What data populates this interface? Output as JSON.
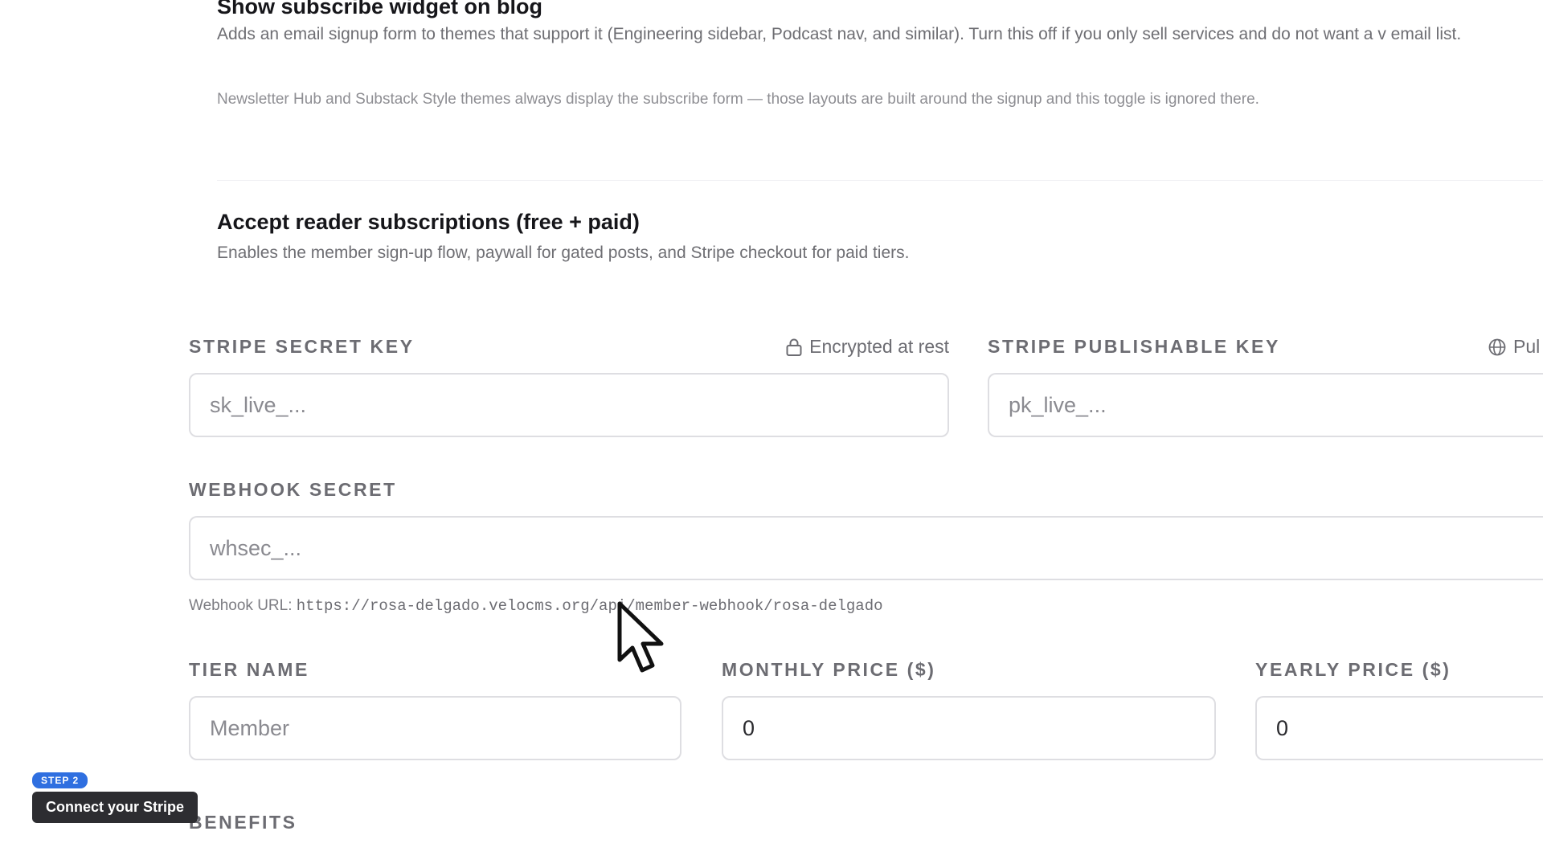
{
  "subscribe_widget": {
    "title": "Show subscribe widget on blog",
    "description": "Adds an email signup form to themes that support it (Engineering sidebar, Podcast nav, and similar). Turn this off if you only sell services and do not want a v email list.",
    "note": "Newsletter Hub and Substack Style themes always display the subscribe form — those layouts are built around the signup and this toggle is ignored there."
  },
  "reader_subscriptions": {
    "title": "Accept reader subscriptions (free + paid)",
    "description": "Enables the member sign-up flow, paywall for gated posts, and Stripe checkout for paid tiers."
  },
  "stripe": {
    "secret_key": {
      "label": "STRIPE SECRET KEY",
      "meta": "Encrypted at rest",
      "placeholder": "sk_live_..."
    },
    "publishable_key": {
      "label": "STRIPE PUBLISHABLE KEY",
      "meta": "Pul",
      "placeholder": "pk_live_..."
    },
    "webhook_secret": {
      "label": "WEBHOOK SECRET",
      "placeholder": "whsec_..."
    },
    "webhook_url": {
      "label": "Webhook URL:",
      "value": "https://rosa-delgado.velocms.org/api/member-webhook/rosa-delgado"
    }
  },
  "tier": {
    "name": {
      "label": "TIER NAME",
      "placeholder": "Member"
    },
    "monthly_price": {
      "label": "MONTHLY PRICE ($)",
      "value": "0"
    },
    "yearly_price": {
      "label": "YEARLY PRICE ($)",
      "value": "0"
    }
  },
  "benefits": {
    "label": "BENEFITS"
  },
  "tour": {
    "step_badge": "STEP 2",
    "callout": "Connect your Stripe"
  },
  "colors": {
    "accent": "#2f6fe0",
    "callout_bg": "#2d2d31"
  },
  "icons": {
    "lock": "lock-icon",
    "globe": "globe-icon",
    "cursor": "mouse-cursor-icon"
  }
}
